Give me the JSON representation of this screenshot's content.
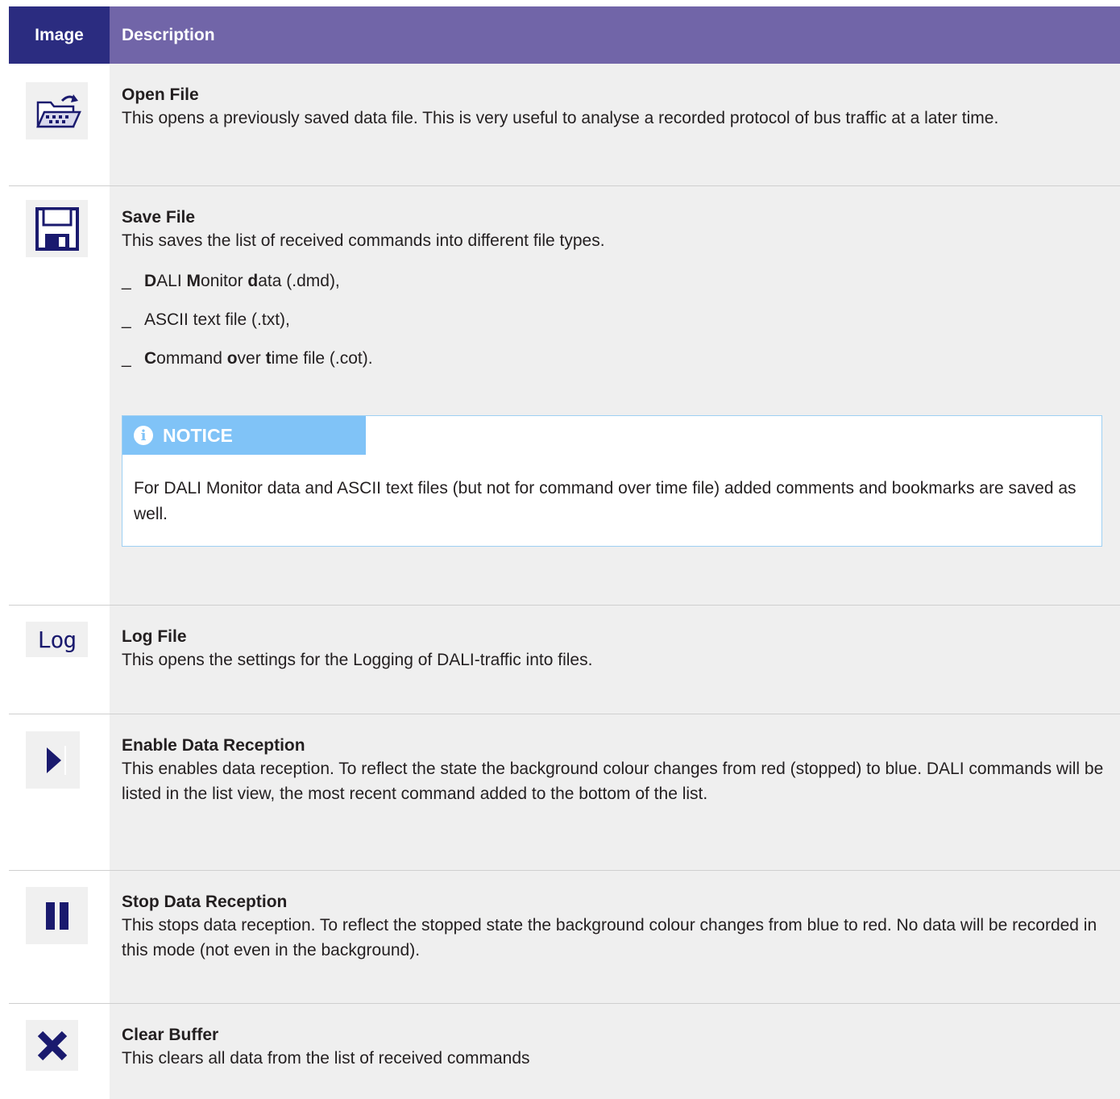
{
  "header": {
    "image": "Image",
    "description": "Description"
  },
  "rows": [
    {
      "icon": "open-folder-icon",
      "title": "Open File",
      "text": "This opens a previously saved data file. This is very useful to analyse a recorded protocol of bus traffic at a later time."
    },
    {
      "icon": "floppy-save-icon",
      "title": "Save File",
      "text": "This saves the list of received commands into different file types.",
      "bullets": [
        {
          "dash": "_",
          "parts": [
            [
              "D",
              true
            ],
            [
              "ALI ",
              false
            ],
            [
              "M",
              true
            ],
            [
              "onitor ",
              false
            ],
            [
              "d",
              true
            ],
            [
              "ata (.dmd),",
              false
            ]
          ]
        },
        {
          "dash": "_",
          "parts": [
            [
              "ASCII text file (.txt),",
              false
            ]
          ]
        },
        {
          "dash": "_",
          "parts": [
            [
              "C",
              true
            ],
            [
              "ommand ",
              false
            ],
            [
              "o",
              true
            ],
            [
              "ver ",
              false
            ],
            [
              "t",
              true
            ],
            [
              "ime file (.cot).",
              false
            ]
          ]
        }
      ],
      "notice": {
        "label": "NOTICE",
        "icon": "info-icon",
        "text": "For DALI Monitor data and ASCII text files (but not for command over time file) added comments and bookmarks are saved as well."
      }
    },
    {
      "icon": "log-icon",
      "icon_text": "Log",
      "title": "Log File",
      "text": "This opens the settings for the Logging of DALI-traffic into files."
    },
    {
      "icon": "play-icon",
      "title": "Enable Data Reception",
      "text": "This enables data reception. To reflect the state the background colour changes from red (stopped) to blue. DALI commands will be listed in the list view, the most recent command added to the bottom of the list."
    },
    {
      "icon": "pause-icon",
      "title": "Stop Data Reception",
      "text": "This stops data reception. To reflect the stopped state the background colour changes from blue to red. No data will be recorded in this mode (not even in the background)."
    },
    {
      "icon": "close-x-icon",
      "title": "Clear Buffer",
      "text": "This clears all data from the list of received commands"
    }
  ],
  "colors": {
    "header_dark": "#2b2c80",
    "header_purple": "#7165a8",
    "notice_blue": "#80c3f7",
    "icon_navy": "#1a1a6e"
  }
}
